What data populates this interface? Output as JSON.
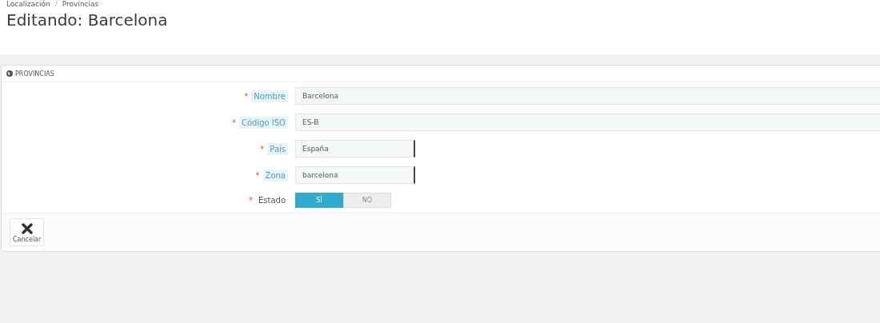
{
  "breadcrumb": [
    "Localización",
    "Provincias"
  ],
  "breadcrumb_separator": "/",
  "title": "Editando: Barcelona",
  "panel": {
    "heading": "PROVINCIAS",
    "fields": [
      {
        "kind": "text",
        "label": "Nombre",
        "required_mark": "*",
        "hint": true,
        "value": "Barcelona"
      },
      {
        "kind": "text",
        "label": "Código ISO",
        "required_mark": "*",
        "hint": true,
        "value": "ES-B"
      },
      {
        "kind": "select",
        "label": "País",
        "required_mark": "*",
        "hint": true,
        "value": "España"
      },
      {
        "kind": "select",
        "label": "Zona",
        "required_mark": "*",
        "hint": true,
        "value": "barcelona"
      },
      {
        "kind": "switch",
        "label": "Estado",
        "required_mark": "*",
        "hint": false,
        "options": [
          {
            "label": "SÍ",
            "selected": true
          },
          {
            "label": "NO",
            "selected": false
          }
        ]
      }
    ],
    "cancel": "Cancelar"
  }
}
